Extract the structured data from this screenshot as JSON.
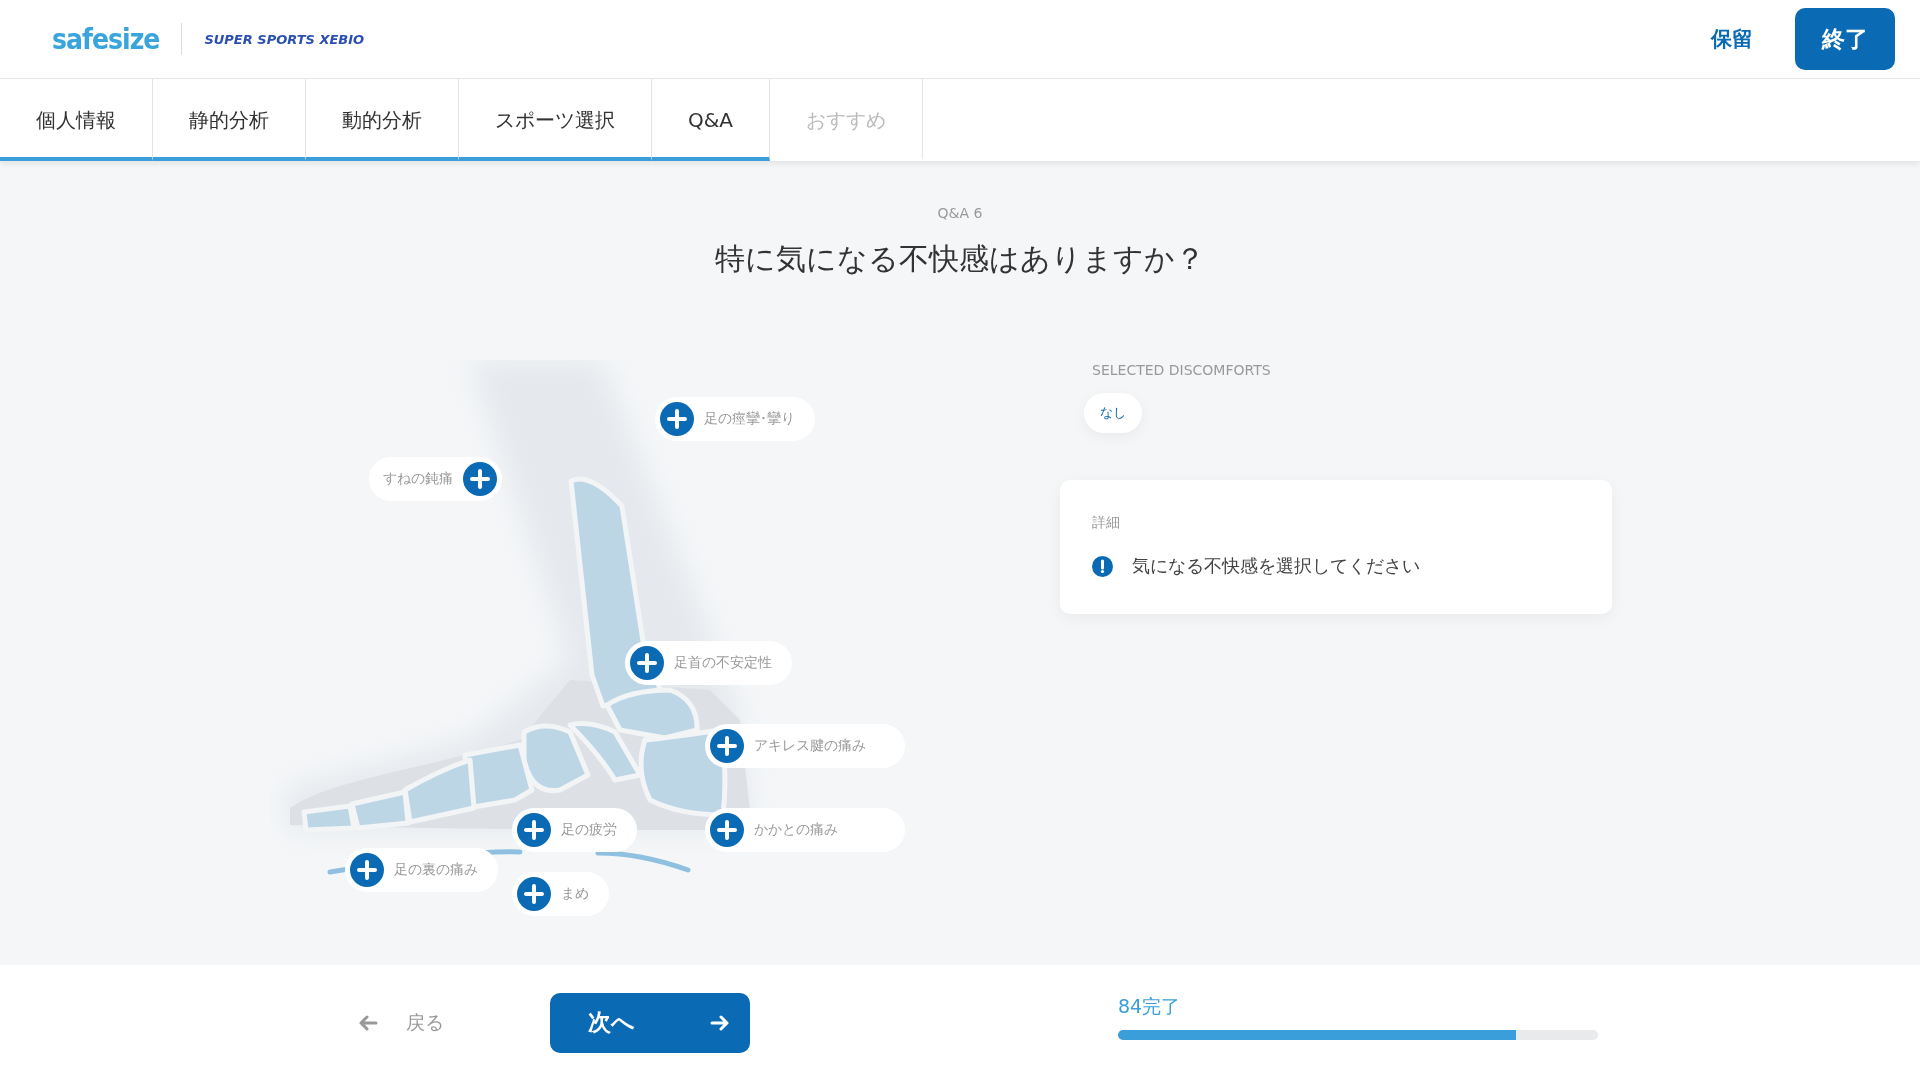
{
  "header": {
    "logo": "safesize",
    "partner_logo": "SUPER SPORTS XEBIO",
    "hold_button": "保留",
    "finish_button": "終了"
  },
  "tabs": [
    {
      "label": "個人情報",
      "completed": true,
      "disabled": false
    },
    {
      "label": "静的分析",
      "completed": true,
      "disabled": false
    },
    {
      "label": "動的分析",
      "completed": true,
      "disabled": false
    },
    {
      "label": "スポーツ選択",
      "completed": true,
      "disabled": false
    },
    {
      "label": "Q&A",
      "completed": true,
      "disabled": false
    },
    {
      "label": "おすすめ",
      "completed": false,
      "disabled": true
    }
  ],
  "question": {
    "step": "Q&A 6",
    "title": "特に気になる不快感はありますか？"
  },
  "discomforts": [
    {
      "label": "足の痙攣･攣り",
      "kind": "icon-first",
      "selected": false
    },
    {
      "label": "すねの鈍痛",
      "kind": "icon-last",
      "selected": false
    },
    {
      "label": "足首の不安定性",
      "kind": "icon-first",
      "selected": false
    },
    {
      "label": "アキレス腱の痛み",
      "kind": "icon-first",
      "selected": false
    },
    {
      "label": "かかとの痛み",
      "kind": "icon-first",
      "selected": false
    },
    {
      "label": "足の疲労",
      "kind": "icon-first",
      "selected": false
    },
    {
      "label": "足の裏の痛み",
      "kind": "icon-first",
      "selected": false
    },
    {
      "label": "まめ",
      "kind": "icon-first",
      "selected": false
    }
  ],
  "selected_panel": {
    "heading": "SELECTED DISCOMFORTS",
    "chips": [
      "なし"
    ]
  },
  "detail_card": {
    "heading": "詳細",
    "message": "気になる不快感を選択してください"
  },
  "footer": {
    "back_button": "戻る",
    "next_button": "次へ",
    "progress": {
      "label": "84完了",
      "level": 0.83
    }
  }
}
